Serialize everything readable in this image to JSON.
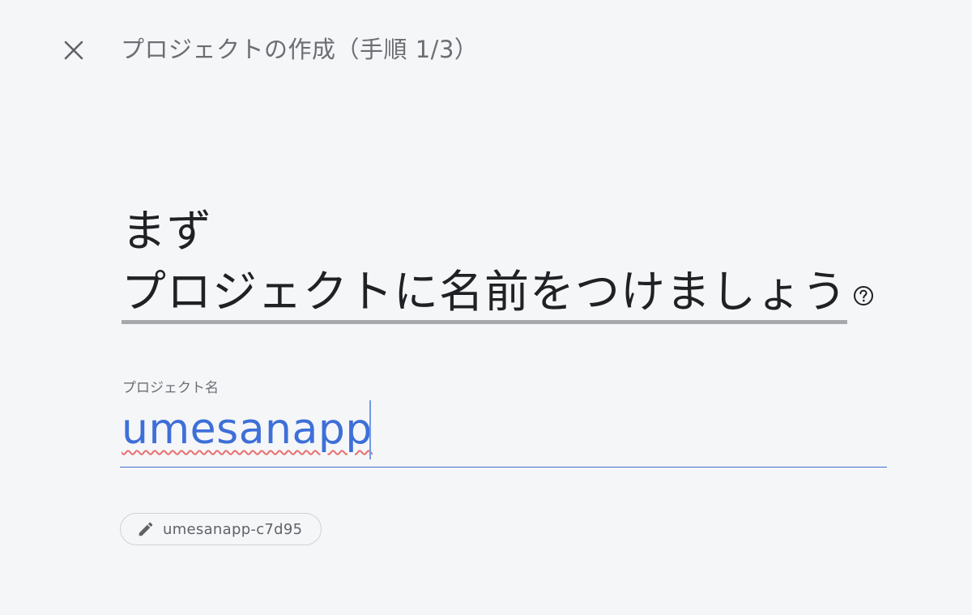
{
  "header": {
    "close_icon": "close-icon",
    "title": "プロジェクトの作成（手順 1/3）"
  },
  "main": {
    "heading_line1": "まず",
    "heading_line2": "プロジェクトに名前をつけましょう",
    "help_icon": "help-circle-icon",
    "project_name_label": "プロジェクト名",
    "project_name_value": "umesanapp",
    "project_id_icon": "pencil-icon",
    "project_id": "umesanapp-c7d95"
  },
  "colors": {
    "background": "#f5f6f8",
    "accent": "#3e6fd8",
    "spellcheck": "#e86f6f"
  }
}
